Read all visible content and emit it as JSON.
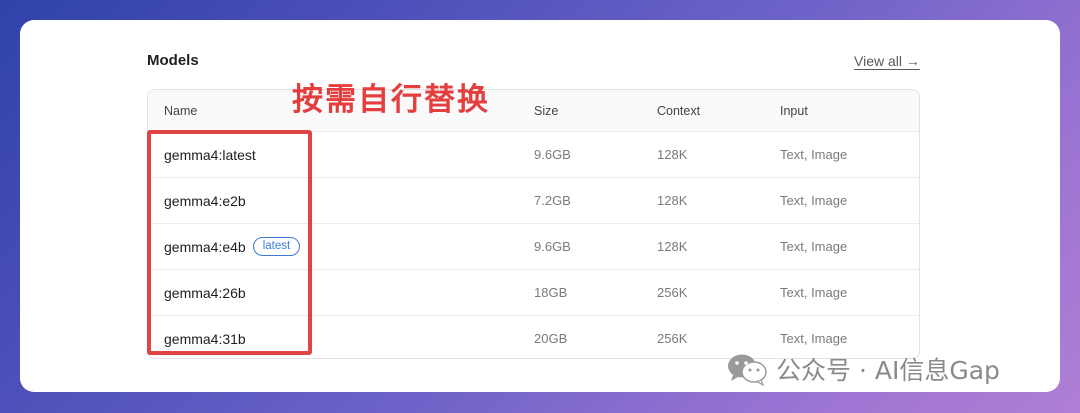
{
  "section": {
    "title": "Models",
    "view_all": "View all →"
  },
  "table": {
    "columns": [
      "Name",
      "Size",
      "Context",
      "Input"
    ],
    "rows": [
      {
        "name": "gemma4:latest",
        "badge": "",
        "size": "9.6GB",
        "context": "128K",
        "input": "Text, Image"
      },
      {
        "name": "gemma4:e2b",
        "badge": "",
        "size": "7.2GB",
        "context": "128K",
        "input": "Text, Image"
      },
      {
        "name": "gemma4:e4b",
        "badge": "latest",
        "size": "9.6GB",
        "context": "128K",
        "input": "Text, Image"
      },
      {
        "name": "gemma4:26b",
        "badge": "",
        "size": "18GB",
        "context": "256K",
        "input": "Text, Image"
      },
      {
        "name": "gemma4:31b",
        "badge": "",
        "size": "20GB",
        "context": "256K",
        "input": "Text, Image"
      }
    ]
  },
  "annotation": {
    "text": "按需自行替换",
    "color": "#e53e3e"
  },
  "watermark": {
    "text": "公众号 · AI信息Gap",
    "icon": "wechat-icon"
  },
  "colors": {
    "badge": "#3b7bd6",
    "background_start": "#2f43a8",
    "background_end": "#b07fd6"
  }
}
